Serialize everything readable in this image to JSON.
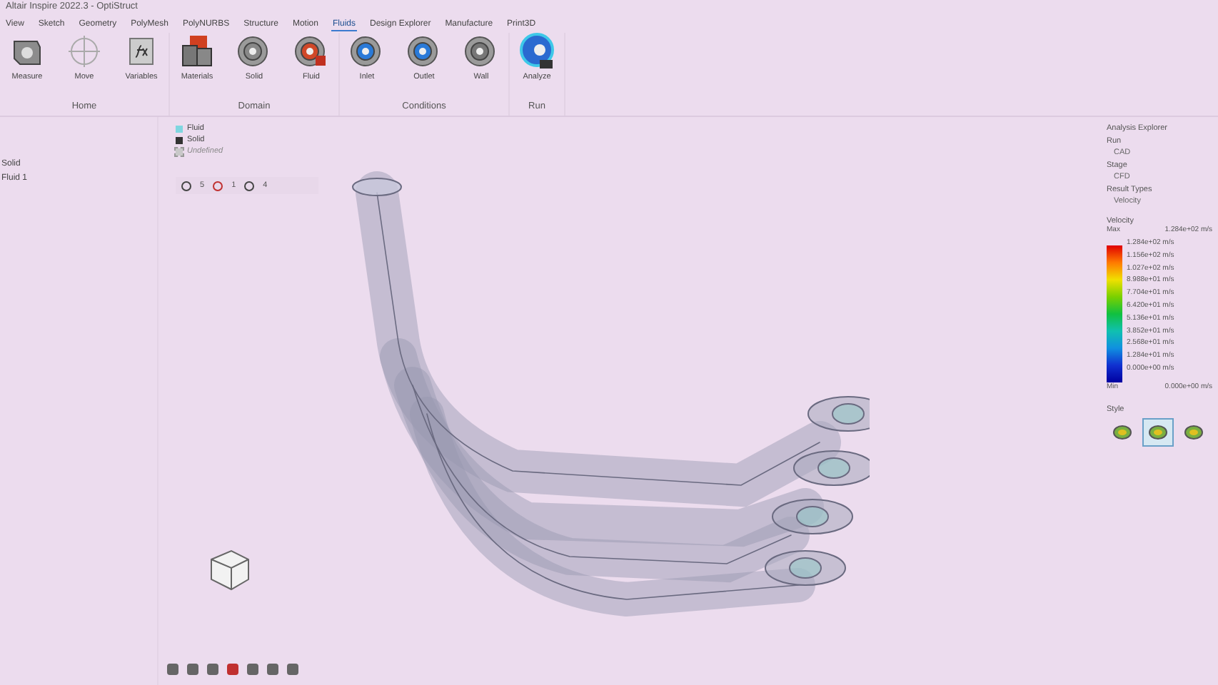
{
  "window": {
    "title": "Altair Inspire 2022.3 - OptiStruct"
  },
  "menu_tabs": [
    {
      "label": "View",
      "selected": false
    },
    {
      "label": "Sketch",
      "selected": false
    },
    {
      "label": "Geometry",
      "selected": false
    },
    {
      "label": "PolyMesh",
      "selected": false
    },
    {
      "label": "PolyNURBS",
      "selected": false
    },
    {
      "label": "Structure",
      "selected": false
    },
    {
      "label": "Motion",
      "selected": false
    },
    {
      "label": "Fluids",
      "selected": true
    },
    {
      "label": "Design Explorer",
      "selected": false
    },
    {
      "label": "Manufacture",
      "selected": false
    },
    {
      "label": "Print3D",
      "selected": false
    }
  ],
  "ribbon_groups": [
    {
      "label": "Home",
      "tools": [
        {
          "label": "Measure",
          "kind": "measure"
        },
        {
          "label": "Move",
          "kind": "move"
        },
        {
          "label": "Variables",
          "kind": "variables"
        }
      ]
    },
    {
      "label": "Domain",
      "tools": [
        {
          "label": "Materials",
          "kind": "materials"
        },
        {
          "label": "Solid",
          "kind": "solid"
        },
        {
          "label": "Fluid",
          "kind": "fluid"
        }
      ]
    },
    {
      "label": "Conditions",
      "tools": [
        {
          "label": "Inlet",
          "kind": "inlet"
        },
        {
          "label": "Outlet",
          "kind": "outlet"
        },
        {
          "label": "Wall",
          "kind": "wall"
        }
      ]
    },
    {
      "label": "Run",
      "tools": [
        {
          "label": "Analyze",
          "kind": "analyze"
        }
      ]
    }
  ],
  "model_tree": {
    "items": [
      "Solid",
      "Fluid 1"
    ]
  },
  "material_legend": [
    {
      "label": "Fluid",
      "color": "#7fd6e0",
      "disabled": false
    },
    {
      "label": "Solid",
      "color": "#333333",
      "disabled": false
    },
    {
      "label": "Undefined",
      "color": "#c8c8c8",
      "disabled": true
    }
  ],
  "view_toolbar": [
    "5",
    "1",
    "4"
  ],
  "analysis_explorer": {
    "title": "Analysis Explorer",
    "fields": [
      {
        "label": "Run",
        "value": "CAD"
      },
      {
        "label": "Stage",
        "value": "CFD"
      },
      {
        "label": "Result Types",
        "value": "Velocity"
      }
    ],
    "legend": {
      "title": "Velocity",
      "max_label": "Max",
      "max_value": "1.284e+02 m/s",
      "min_label": "Min",
      "min_value": "0.000e+00 m/s",
      "ticks": [
        "1.284e+02 m/s",
        "1.156e+02 m/s",
        "1.027e+02 m/s",
        "8.988e+01 m/s",
        "7.704e+01 m/s",
        "6.420e+01 m/s",
        "5.136e+01 m/s",
        "3.852e+01 m/s",
        "2.568e+01 m/s",
        "1.284e+01 m/s",
        "0.000e+00 m/s"
      ]
    },
    "style_label": "Style",
    "styles": [
      {
        "selected": false
      },
      {
        "selected": true
      },
      {
        "selected": false
      }
    ]
  }
}
